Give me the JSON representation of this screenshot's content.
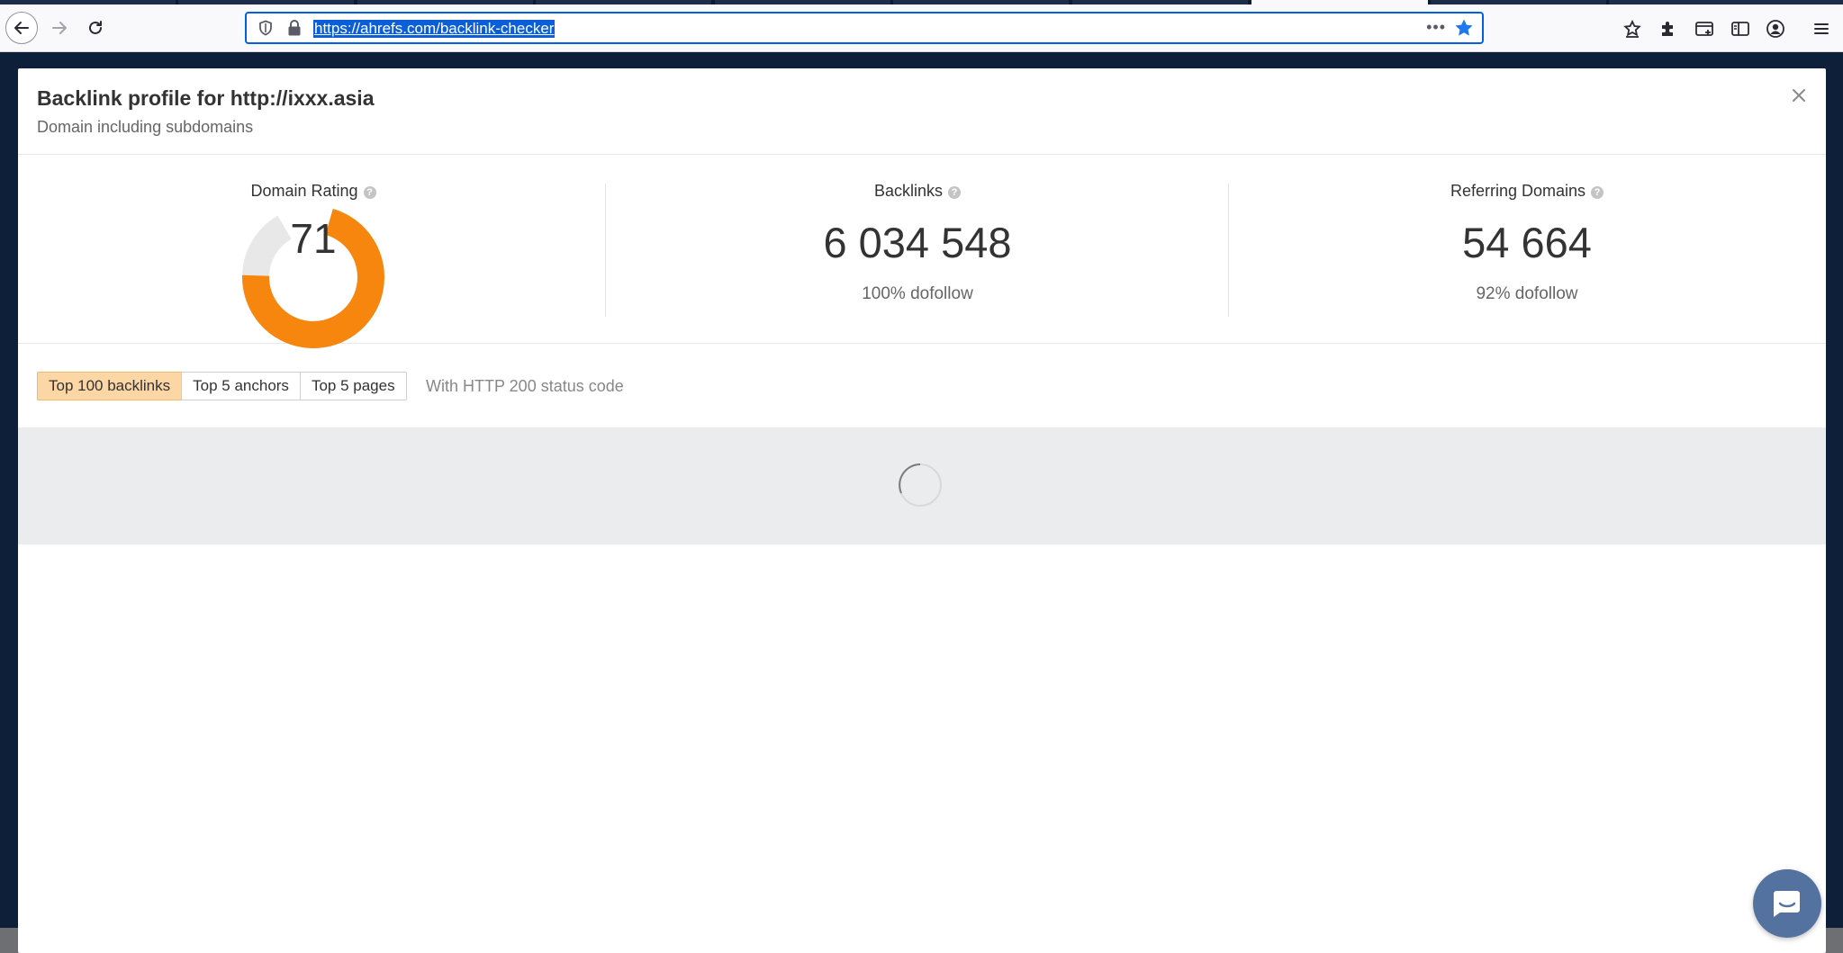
{
  "browser": {
    "url": "https://ahrefs.com/backlink-checker",
    "colors": {
      "accent": "#0061e0",
      "star": "#1e78f0"
    }
  },
  "modal": {
    "title": "Backlink profile for http://ixxx.asia",
    "subtitle": "Domain including subdomains"
  },
  "stats": {
    "domain_rating": {
      "label": "Domain Rating",
      "value": "71",
      "rating": 71,
      "max": 100,
      "color": "#f7860e"
    },
    "backlinks": {
      "label": "Backlinks",
      "value": "6 034 548",
      "sub": "100% dofollow"
    },
    "referring_domains": {
      "label": "Referring Domains",
      "value": "54 664",
      "sub": "92% dofollow"
    },
    "help_glyph": "?"
  },
  "tabs": [
    {
      "label": "Top 100 backlinks",
      "active": true
    },
    {
      "label": "Top 5 anchors",
      "active": false
    },
    {
      "label": "Top 5 pages",
      "active": false
    }
  ],
  "status_note": "With HTTP 200 status code",
  "icons": {
    "back": "arrow-left-icon",
    "forward": "arrow-right-icon",
    "reload": "reload-icon",
    "shield": "tracking-shield-icon",
    "lock": "lock-icon",
    "more": "more-icon",
    "bookmark": "star-icon",
    "pocket": "pocket-icon",
    "extensions": "puzzle-icon",
    "containers": "container-tab-icon",
    "sidebar": "sidebar-icon",
    "account": "account-icon",
    "menu": "hamburger-menu-icon",
    "close": "close-icon",
    "spinner": "loading-spinner-icon",
    "chat": "chat-icon"
  }
}
